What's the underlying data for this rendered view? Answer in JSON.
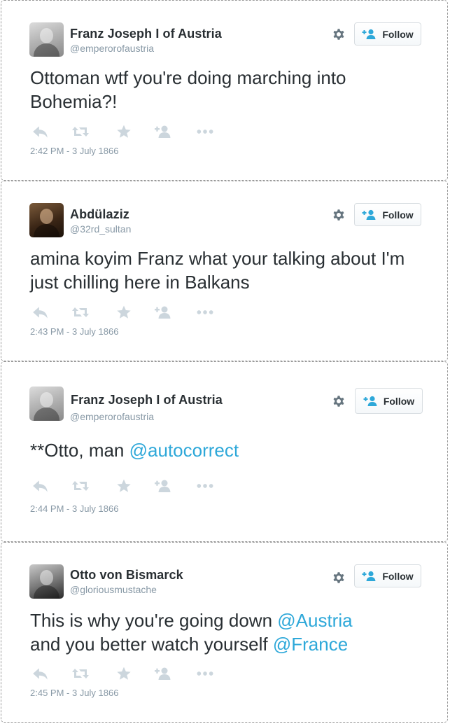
{
  "tweets": [
    {
      "name": "Franz Joseph I of Austria",
      "handle": "@emperorofaustria",
      "follow_label": "Follow",
      "text_parts": [
        "Ottoman wtf you're doing marching into Bohemia?!"
      ],
      "timestamp": "2:42 PM - 3 July 1866",
      "avatar": "franz-joseph-avatar"
    },
    {
      "name": "Abdülaziz",
      "handle": "@32rd_sultan",
      "follow_label": "Follow",
      "text_parts": [
        "amina koyim Franz what your talking about I'm just chilling here in Balkans"
      ],
      "timestamp": "2:43 PM - 3 July 1866",
      "avatar": "abdulaziz-avatar"
    },
    {
      "name": "Franz Joseph I of Austria",
      "handle": "@emperorofaustria",
      "follow_label": "Follow",
      "text_plain": "**Otto, man ",
      "text_mention": "@autocorrect",
      "timestamp": "2:44 PM - 3 July 1866",
      "avatar": "franz-joseph-avatar"
    },
    {
      "name": "Otto von Bismarck",
      "handle": "@gloriousmustache",
      "follow_label": "Follow",
      "text_plain_1": "This is why you're going down ",
      "text_mention_1": "@Austria",
      "text_plain_2": "and you better watch yourself ",
      "text_mention_2": "@France",
      "timestamp": "2:45 PM - 3 July 1866",
      "avatar": "bismarck-avatar"
    }
  ],
  "icons": {
    "reply": "reply-icon",
    "retweet": "retweet-icon",
    "favorite": "star-icon",
    "follow_small": "add-user-icon",
    "more": "more-icon",
    "settings": "gear-icon"
  },
  "colors": {
    "mention": "#2ea8d9",
    "muted": "#8899a6",
    "icon": "#ccd6dd",
    "text": "#292f33"
  }
}
